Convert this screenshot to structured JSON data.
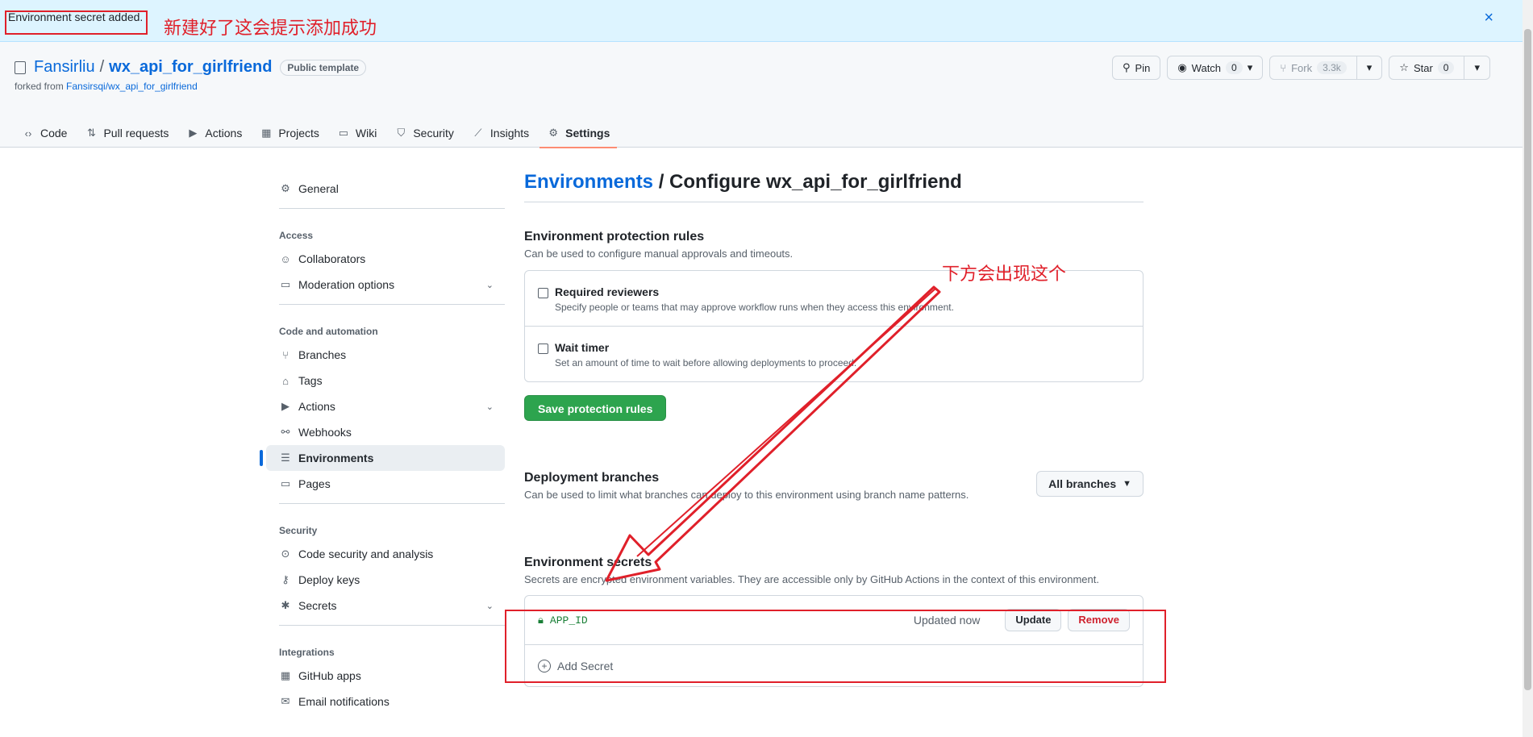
{
  "flash": {
    "message": "Environment secret added.",
    "close_icon": "×"
  },
  "annotations": {
    "flash_note": "新建好了这会提示添加成功",
    "arrow_note": "下方会出现这个",
    "color": "#e0202a"
  },
  "repo": {
    "owner": "Fansirliu",
    "separator": "/",
    "name": "wx_api_for_girlfriend",
    "badge": "Public template",
    "forked_prefix": "forked from",
    "forked_link": "Fansirsqi/wx_api_for_girlfriend"
  },
  "actions": {
    "pin": "Pin",
    "watch": "Watch",
    "watch_count": "0",
    "fork": "Fork",
    "fork_count": "3.3k",
    "star": "Star",
    "star_count": "0"
  },
  "tabs": [
    {
      "label": "Code",
      "icon": "code-icon",
      "glyph": "‹›"
    },
    {
      "label": "Pull requests",
      "icon": "pull-request-icon",
      "glyph": "⇅"
    },
    {
      "label": "Actions",
      "icon": "play-icon",
      "glyph": "▶"
    },
    {
      "label": "Projects",
      "icon": "table-icon",
      "glyph": "▦"
    },
    {
      "label": "Wiki",
      "icon": "book-icon",
      "glyph": "▭"
    },
    {
      "label": "Security",
      "icon": "shield-icon",
      "glyph": "⛉"
    },
    {
      "label": "Insights",
      "icon": "graph-icon",
      "glyph": "⟋"
    },
    {
      "label": "Settings",
      "icon": "gear-icon",
      "glyph": "⚙"
    }
  ],
  "sidebar": {
    "general": "General",
    "access_heading": "Access",
    "collaborators": "Collaborators",
    "moderation": "Moderation options",
    "code_heading": "Code and automation",
    "branches": "Branches",
    "tags": "Tags",
    "actions": "Actions",
    "webhooks": "Webhooks",
    "environments": "Environments",
    "pages": "Pages",
    "security_heading": "Security",
    "code_security": "Code security and analysis",
    "deploy_keys": "Deploy keys",
    "secrets": "Secrets",
    "integrations_heading": "Integrations",
    "github_apps": "GitHub apps",
    "email_notifications": "Email notifications"
  },
  "main": {
    "title_link": "Environments",
    "title_rest": "/ Configure wx_api_for_girlfriend",
    "protection_title": "Environment protection rules",
    "protection_desc": "Can be used to configure manual approvals and timeouts.",
    "reviewers_label": "Required reviewers",
    "reviewers_desc": "Specify people or teams that may approve workflow runs when they access this environment.",
    "timer_label": "Wait timer",
    "timer_desc": "Set an amount of time to wait before allowing deployments to proceed.",
    "save_button": "Save protection rules",
    "deploy_title": "Deployment branches",
    "deploy_desc": "Can be used to limit what branches can deploy to this environment using branch name patterns.",
    "branches_button": "All branches",
    "secrets_title": "Environment secrets",
    "secrets_desc": "Secrets are encrypted environment variables. They are accessible only by GitHub Actions in the context of this environment.",
    "secret_name": "APP_ID",
    "secret_updated": "Updated now",
    "update_button": "Update",
    "remove_button": "Remove",
    "add_secret": "Add Secret"
  }
}
